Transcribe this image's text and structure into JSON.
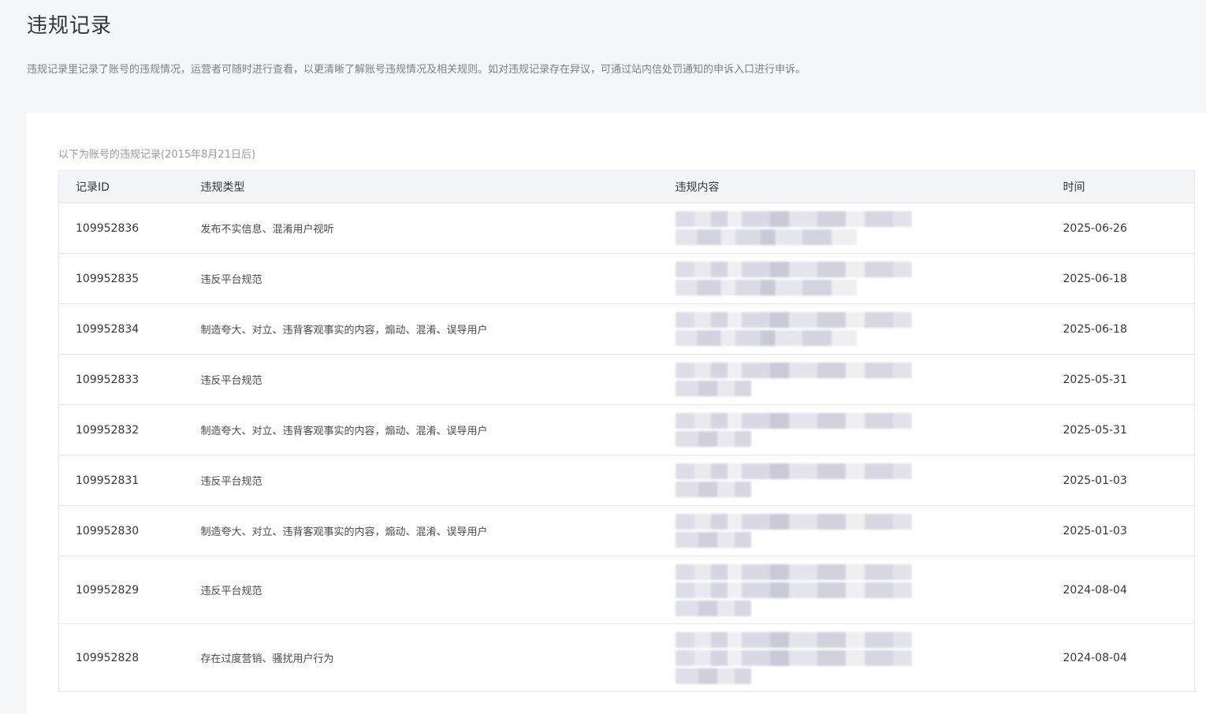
{
  "page": {
    "title": "违规记录",
    "description": "违规记录里记录了账号的违规情况，运营者可随时进行查看，以更清晰了解账号违规情况及相关规则。如对违规记录存在异议，可通过站内信处罚通知的申诉入口进行申诉。"
  },
  "records": {
    "caption": "以下为账号的违规记录(2015年8月21日后)",
    "columns": {
      "id": "记录ID",
      "type": "违规类型",
      "content": "违规内容",
      "time": "时间"
    },
    "rows": [
      {
        "id": "109952836",
        "type": "发布不实信息、混淆用户视听",
        "time": "2025-06-26"
      },
      {
        "id": "109952835",
        "type": "违反平台规范",
        "time": "2025-06-18"
      },
      {
        "id": "109952834",
        "type": "制造夸大、对立、违背客观事实的内容，煽动、混淆、误导用户",
        "time": "2025-06-18"
      },
      {
        "id": "109952833",
        "type": "违反平台规范",
        "time": "2025-05-31"
      },
      {
        "id": "109952832",
        "type": "制造夸大、对立、违背客观事实的内容，煽动、混淆、误导用户",
        "time": "2025-05-31"
      },
      {
        "id": "109952831",
        "type": "违反平台规范",
        "time": "2025-01-03"
      },
      {
        "id": "109952830",
        "type": "制造夸大、对立、违背客观事实的内容，煽动、混淆、误导用户",
        "time": "2025-01-03"
      },
      {
        "id": "109952829",
        "type": "违反平台规范",
        "time": "2024-08-04"
      },
      {
        "id": "109952828",
        "type": "存在过度营销、骚扰用户行为",
        "time": "2024-08-04"
      }
    ]
  }
}
